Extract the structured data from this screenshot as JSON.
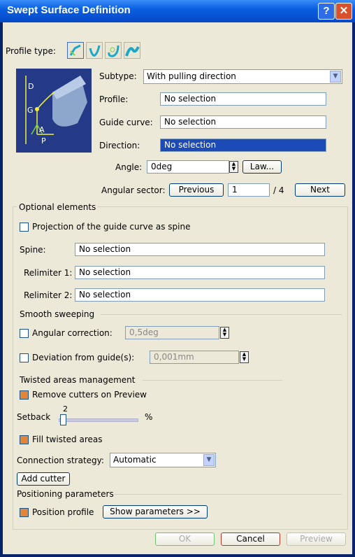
{
  "window": {
    "title": "Swept Surface Definition",
    "help_label": "?",
    "close_label": "✕"
  },
  "profile_type": {
    "label": "Profile type:",
    "icons": [
      "line-profile-icon",
      "circle-profile-icon",
      "conic-profile-icon",
      "explicit-profile-icon"
    ]
  },
  "preview": {
    "labels": {
      "d": "D",
      "g": "G",
      "a": "A",
      "p": "P"
    }
  },
  "subtype": {
    "label": "Subtype:",
    "value": "With pulling direction"
  },
  "profile": {
    "label": "Profile:",
    "value": "No selection"
  },
  "guide_curve": {
    "label": "Guide curve:",
    "value": "No selection"
  },
  "direction": {
    "label": "Direction:",
    "value": "No selection"
  },
  "angle": {
    "label": "Angle:",
    "value": "0deg",
    "law_label": "Law..."
  },
  "angular_sector": {
    "label": "Angular sector:",
    "previous_label": "Previous",
    "value": "1",
    "total": "/ 4",
    "next_label": "Next"
  },
  "optional": {
    "title": "Optional elements",
    "projection_label": "Projection of the guide curve as spine",
    "spine_label": "Spine:",
    "spine_value": "No selection",
    "relimiter1_label": "Relimiter 1:",
    "relimiter1_value": "No selection",
    "relimiter2_label": "Relimiter 2:",
    "relimiter2_value": "No selection"
  },
  "smooth": {
    "title": "Smooth sweeping",
    "angular_label": "Angular correction:",
    "angular_value": "0,5deg",
    "deviation_label": "Deviation from guide(s):",
    "deviation_value": "0,001mm"
  },
  "twisted": {
    "title": "Twisted areas management",
    "remove_cutters_label": "Remove cutters on Preview",
    "setback_label": "Setback",
    "setback_value": "2",
    "setback_unit": "%",
    "setback_fraction": 0.02,
    "fill_label": "Fill twisted areas",
    "connection_label": "Connection strategy:",
    "connection_value": "Automatic",
    "add_cutter_label": "Add cutter"
  },
  "positioning": {
    "title": "Positioning parameters",
    "position_label": "Position profile",
    "show_params_label": "Show parameters >>"
  },
  "footer": {
    "ok_label": "OK",
    "cancel_label": "Cancel",
    "preview_label": "Preview"
  },
  "colors": {
    "titlebar": "#0a5fe0",
    "selection": "#1c4bb8",
    "checked": "#e0853a",
    "dialog_bg": "#ece9d8"
  }
}
